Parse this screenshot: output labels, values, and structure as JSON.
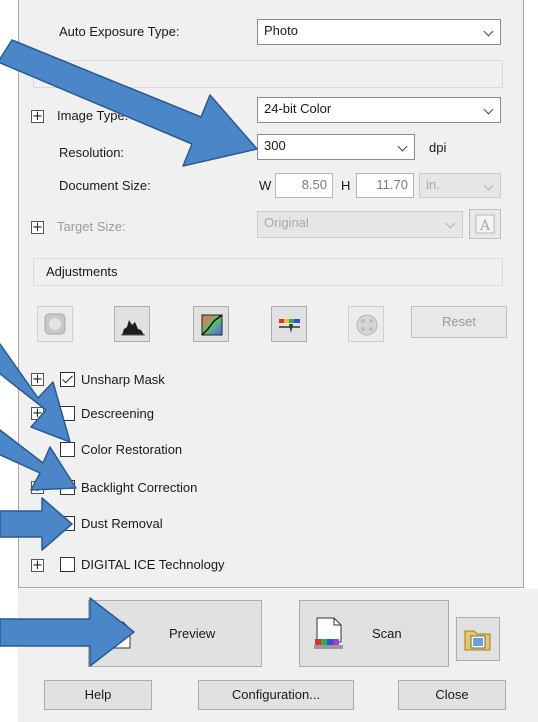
{
  "colors": {
    "arrow_fill": "#4a86c8",
    "arrow_stroke": "#2b5a90",
    "panel": "#f0f0f0"
  },
  "auto_exposure": {
    "label": "Auto Exposure Type:",
    "value": "Photo"
  },
  "image_type": {
    "label": "Image Type:",
    "value": "24-bit Color"
  },
  "resolution": {
    "label": "Resolution:",
    "value": "300",
    "unit": "dpi"
  },
  "document_size": {
    "label": "Document Size:",
    "w_label": "W",
    "w_value": "8.50",
    "h_label": "H",
    "h_value": "11.70",
    "unit": "in."
  },
  "target_size": {
    "label": "Target Size:",
    "value": "Original"
  },
  "adjustments": {
    "title": "Adjustments",
    "tools": [
      "auto-exposure-icon",
      "histogram-icon",
      "tone-curve-icon",
      "image-adjust-icon",
      "color-palette-icon"
    ],
    "reset_label": "Reset"
  },
  "options": [
    {
      "label": "Unsharp Mask",
      "checked": true
    },
    {
      "label": "Descreening",
      "checked": false
    },
    {
      "label": "Color Restoration",
      "checked": false
    },
    {
      "label": "Backlight Correction",
      "checked": false
    },
    {
      "label": "Dust Removal",
      "checked": false
    },
    {
      "label": "DIGITAL ICE Technology",
      "checked": false
    }
  ],
  "actions": {
    "preview": "Preview",
    "scan": "Scan"
  },
  "footer": {
    "help": "Help",
    "configuration": "Configuration...",
    "close": "Close"
  }
}
